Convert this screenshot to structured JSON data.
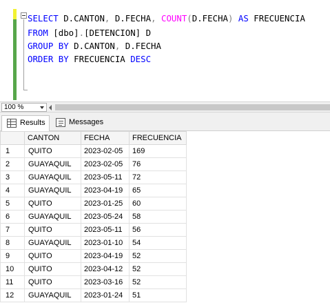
{
  "editor": {
    "lines": [
      {
        "kw1": "SELECT",
        "tx1": " D.CANTON",
        "op1": ",",
        "tx2": " D.FECHA",
        "op2": ",",
        "fn1": " COUNT",
        "op3": "(",
        "tx3": "D.FECHA",
        "op4": ")",
        "kw2": " AS",
        "tx4": " FRECUENCIA"
      },
      {
        "kw1": "FROM",
        "tx1": " [dbo]",
        "op1": ".",
        "tx2": "[DETENCION] D"
      },
      {
        "kw1": "GROUP BY",
        "tx1": " D.CANTON",
        "op1": ",",
        "tx2": " D.FECHA"
      },
      {
        "kw1": "ORDER BY",
        "tx1": " FRECUENCIA",
        "kw2": " DESC"
      }
    ]
  },
  "zoom": {
    "value": "100 %"
  },
  "tabs": {
    "results": "Results",
    "messages": "Messages"
  },
  "grid": {
    "columns": [
      "CANTON",
      "FECHA",
      "FRECUENCIA"
    ],
    "rows": [
      {
        "n": "1",
        "canton": "QUITO",
        "fecha": "2023-02-05",
        "frecuencia": "169"
      },
      {
        "n": "2",
        "canton": "GUAYAQUIL",
        "fecha": "2023-02-05",
        "frecuencia": "76"
      },
      {
        "n": "3",
        "canton": "GUAYAQUIL",
        "fecha": "2023-05-11",
        "frecuencia": "72"
      },
      {
        "n": "4",
        "canton": "GUAYAQUIL",
        "fecha": "2023-04-19",
        "frecuencia": "65"
      },
      {
        "n": "5",
        "canton": "QUITO",
        "fecha": "2023-01-25",
        "frecuencia": "60"
      },
      {
        "n": "6",
        "canton": "GUAYAQUIL",
        "fecha": "2023-05-24",
        "frecuencia": "58"
      },
      {
        "n": "7",
        "canton": "QUITO",
        "fecha": "2023-05-11",
        "frecuencia": "56"
      },
      {
        "n": "8",
        "canton": "GUAYAQUIL",
        "fecha": "2023-01-10",
        "frecuencia": "54"
      },
      {
        "n": "9",
        "canton": "QUITO",
        "fecha": "2023-04-19",
        "frecuencia": "52"
      },
      {
        "n": "10",
        "canton": "QUITO",
        "fecha": "2023-04-12",
        "frecuencia": "52"
      },
      {
        "n": "11",
        "canton": "QUITO",
        "fecha": "2023-03-16",
        "frecuencia": "52"
      },
      {
        "n": "12",
        "canton": "GUAYAQUIL",
        "fecha": "2023-01-24",
        "frecuencia": "51"
      }
    ],
    "selected_cell": {
      "row": 1,
      "column": "CANTON"
    }
  },
  "colors": {
    "keyword": "#0000ff",
    "function": "#ff00ff",
    "operator": "#808080",
    "changed_lines_bar": "#57a64a",
    "current_line_bar": "#f2f233"
  }
}
